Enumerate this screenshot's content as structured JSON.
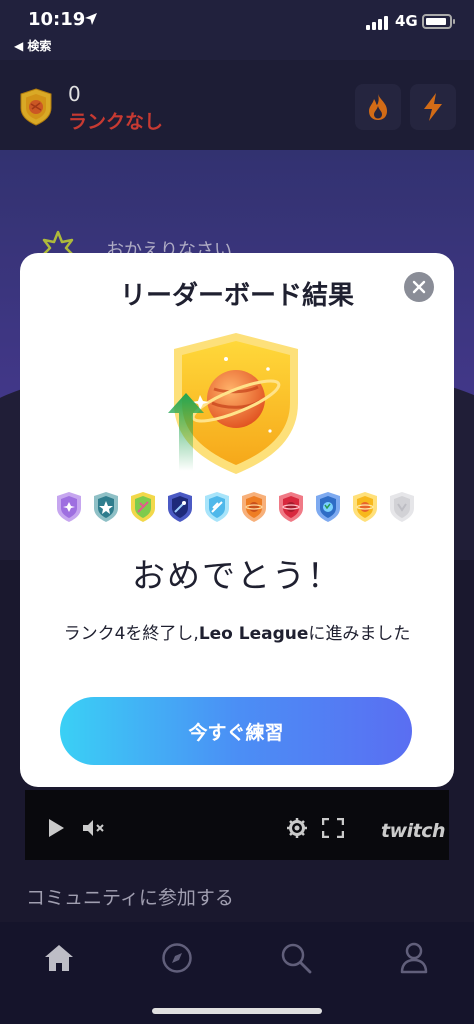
{
  "status_bar": {
    "time": "10:19",
    "network": "4G",
    "back_label": "◀ 検索"
  },
  "header": {
    "points": "0",
    "rank_label": "ランクなし"
  },
  "home": {
    "welcome_text": "おかえりなさい",
    "community_label": "コミュニティに参加する",
    "video_brand": "twitch"
  },
  "modal": {
    "title": "リーダーボード結果",
    "congrats": "おめでとう！",
    "message_prefix": "ランク4を終了し,",
    "league_name": "Leo League",
    "message_suffix": "に進みました",
    "button_label": "今すぐ練習"
  },
  "colors": {
    "rank_none": "#e3423a",
    "button_gradient_start": "#3ad0f5",
    "button_gradient_end": "#5a6ef2",
    "shield_gold": "#f9c020"
  },
  "rank_shields": [
    {
      "name": "shield-rank-1-icon",
      "color": "#b98ee6"
    },
    {
      "name": "shield-rank-2-icon",
      "color": "#2f7d8d"
    },
    {
      "name": "shield-rank-3-icon",
      "color": "#9ad14a"
    },
    {
      "name": "shield-rank-4-icon",
      "color": "#2c3a9a"
    },
    {
      "name": "shield-rank-5-icon",
      "color": "#5cc4ee"
    },
    {
      "name": "shield-rank-6-icon",
      "color": "#f08a2a"
    },
    {
      "name": "shield-rank-7-icon",
      "color": "#e2384a"
    },
    {
      "name": "shield-rank-8-icon",
      "color": "#2f6dc6"
    },
    {
      "name": "shield-rank-9-icon",
      "color": "#f7b81c"
    },
    {
      "name": "shield-rank-10-icon",
      "color": "#d9d9dc"
    }
  ],
  "tabs": [
    {
      "name": "tab-home",
      "icon": "home-icon"
    },
    {
      "name": "tab-explore",
      "icon": "compass-icon"
    },
    {
      "name": "tab-search",
      "icon": "search-icon"
    },
    {
      "name": "tab-profile",
      "icon": "profile-icon"
    }
  ]
}
